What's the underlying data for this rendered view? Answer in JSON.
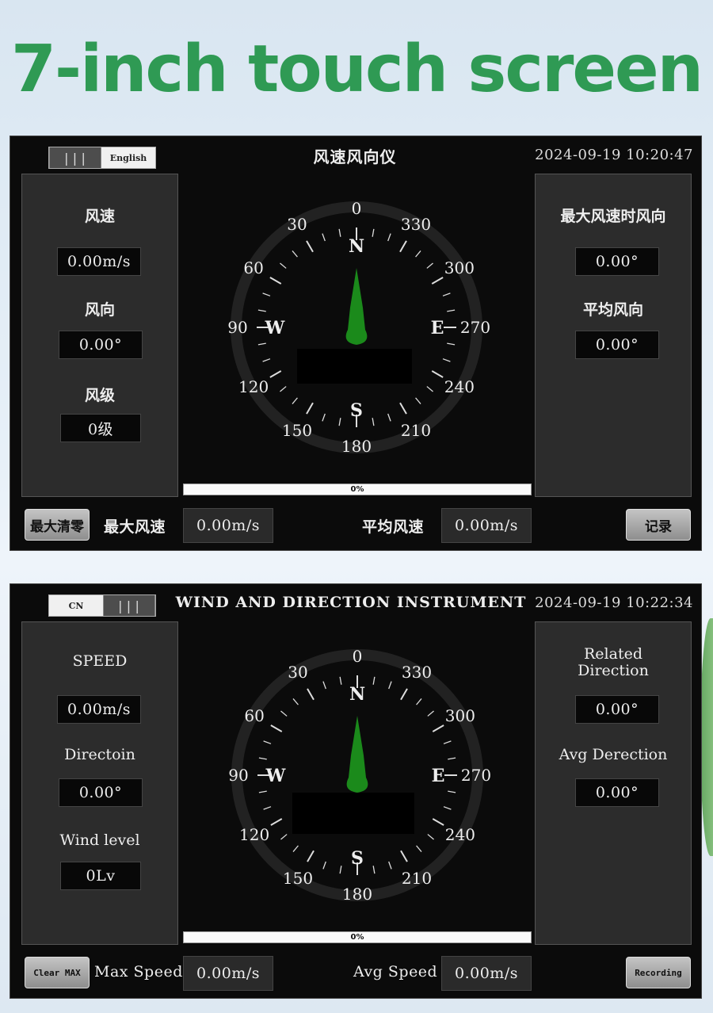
{
  "headline": "7-inch touch screen",
  "compass_labels": {
    "degrees": [
      "0",
      "30",
      "60",
      "90",
      "120",
      "150",
      "180",
      "210",
      "240",
      "270",
      "300",
      "330"
    ],
    "cardinals": {
      "n": "N",
      "e": "E",
      "s": "S",
      "w": "W"
    }
  },
  "colors": {
    "headline": "#2f9a54",
    "needle": "#1b8a1b",
    "screen_bg": "#0b0b0b",
    "panel_bg": "#2c2c2c"
  },
  "screen_cn": {
    "toggle_knob": "|||",
    "toggle_option": "English",
    "title": "风速风向仪",
    "datetime": "2024-09-19 10:20:47",
    "left": {
      "speed_label": "风速",
      "speed_value": "0.00m/s",
      "dir_label": "风向",
      "dir_value": "0.00°",
      "level_label": "风级",
      "level_value": "0级"
    },
    "right": {
      "maxdir_label": "最大风速时风向",
      "maxdir_value": "0.00°",
      "avgdir_label": "平均风向",
      "avgdir_value": "0.00°"
    },
    "progress": "0%",
    "progress_fraction": 0,
    "clear_button": "最大清零",
    "max_speed_label": "最大风速",
    "max_speed_value": "0.00m/s",
    "avg_speed_label": "平均风速",
    "avg_speed_value": "0.00m/s",
    "record_button": "记录"
  },
  "screen_en": {
    "toggle_knob": "|||",
    "toggle_option": "CN",
    "title": "WIND AND DIRECTION INSTRUMENT",
    "datetime": "2024-09-19 10:22:34",
    "left": {
      "speed_label": "SPEED",
      "speed_value": "0.00m/s",
      "dir_label": "Directoin",
      "dir_value": "0.00°",
      "level_label": "Wind level",
      "level_value": "0Lv"
    },
    "right": {
      "maxdir_label_1": "Related",
      "maxdir_label_2": "Direction",
      "maxdir_value": "0.00°",
      "avgdir_label": "Avg Derection",
      "avgdir_value": "0.00°"
    },
    "progress": "0%",
    "progress_fraction": 0,
    "clear_button": "Clear MAX",
    "max_speed_label": "Max Speed",
    "max_speed_value": "0.00m/s",
    "avg_speed_label": "Avg Speed",
    "avg_speed_value": "0.00m/s",
    "record_button": "Recording"
  }
}
